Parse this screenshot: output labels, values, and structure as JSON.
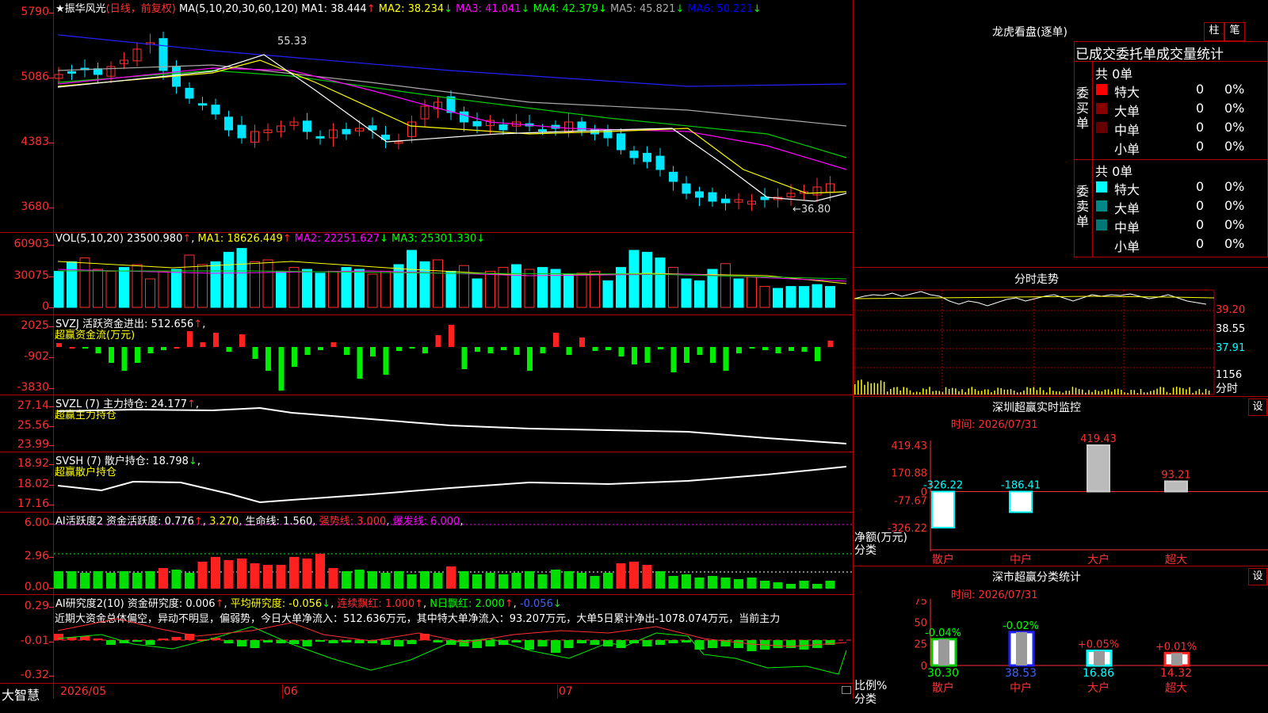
{
  "app": {
    "brand": "大智慧"
  },
  "kline": {
    "star": "★",
    "stock_name": "振华风光",
    "period": "(日线，前复权)",
    "ma_params": "MA(5,10,20,30,60,120)",
    "ma": [
      {
        "label": "MA1:",
        "value": "38.444",
        "arrow": "↑",
        "color": "#ffffff"
      },
      {
        "label": "MA2:",
        "value": "38.234",
        "arrow": "↓",
        "color": "#ffff00"
      },
      {
        "label": "MA3:",
        "value": "41.041",
        "arrow": "↓",
        "color": "#ff00ff"
      },
      {
        "label": "MA4:",
        "value": "42.379",
        "arrow": "↓",
        "color": "#00ff00"
      },
      {
        "label": "MA5:",
        "value": "45.821",
        "arrow": "↓",
        "color": "#aaaaaa"
      },
      {
        "label": "MA6:",
        "value": "50.221",
        "arrow": "↓",
        "color": "#0000ff"
      }
    ],
    "yticks": [
      "5790",
      "5086",
      "4383",
      "3680"
    ],
    "high_label": "55.33",
    "low_label": "←36.80"
  },
  "vol": {
    "header": "VOL(5,10,20)",
    "value": "23500.980",
    "ma": [
      {
        "label": "MA1:",
        "value": "18626.449",
        "arrow": "↑",
        "color": "#ffff00"
      },
      {
        "label": "MA2:",
        "value": "22251.627",
        "arrow": "↓",
        "color": "#ff00ff"
      },
      {
        "label": "MA3:",
        "value": "25301.330",
        "arrow": "↓",
        "color": "#00ff00"
      }
    ],
    "yticks": [
      "60903",
      "30075",
      "0"
    ]
  },
  "svzj": {
    "header": "SVZJ",
    "label": "活跃资金进出:",
    "value": "512.656",
    "arrow": "↑",
    "subtitle": "超赢资金流(万元)",
    "yticks": [
      "2025",
      "-902",
      "-3830"
    ]
  },
  "svzl": {
    "header": "SVZL (7)",
    "label": "主力持仓:",
    "value": "24.177",
    "arrow": "↑",
    "subtitle": "超赢主力持仓",
    "yticks": [
      "27.14",
      "25.56",
      "23.99"
    ]
  },
  "svsh": {
    "header": "SVSH (7)",
    "label": "散户持仓:",
    "value": "18.798",
    "arrow": "↓",
    "subtitle": "超赢散户持仓",
    "yticks": [
      "18.92",
      "18.02",
      "17.16"
    ]
  },
  "ai_active": {
    "header": "AI活跃度2",
    "label": "资金活跃度:",
    "value": "0.776",
    "arrow": "↑",
    "value2": "3.270",
    "life_label": "生命线:",
    "life_value": "1.560",
    "strong_label": "强势线:",
    "strong_value": "3.000",
    "burst_label": "爆发线:",
    "burst_value": "6.000",
    "yticks": [
      "6.00",
      "2.96",
      "0.00"
    ]
  },
  "ai_research": {
    "header": "AI研究度2(10)",
    "label": "资金研究度:",
    "value": "0.006",
    "arrow": "↑",
    "avg_label": "平均研究度:",
    "avg_value": "-0.056",
    "avg_arrow": "↓",
    "cont_label": "连续飘红:",
    "cont_value": "1.000",
    "cont_arrow": "↑",
    "nday_label": "N日飘红:",
    "nday_value": "2.000",
    "nday_arrow": "↑",
    "last_value": "-0.056",
    "last_arrow": "↓",
    "summary": "近期大资金总体偏空，异动不明显，偏弱势，今日大单净流入：512.636万元，其中特大单净流入：93.207万元，大单5日累计净出-1078.074万元，当前主力",
    "yticks": [
      "0.29",
      "-0.01",
      "-0.32"
    ]
  },
  "xaxis": {
    "labels": [
      "2026/05",
      "06",
      "07"
    ]
  },
  "right": {
    "lhb_title": "龙虎看盘(逐单)",
    "btn_bar": "柱",
    "btn_pen": "笔",
    "stats_title": "已成交委托单成交量统计",
    "buy_side": "委买单",
    "sell_side": "委卖单",
    "buy_total": "共 0单",
    "sell_total": "共 0单",
    "buy_rows": [
      {
        "name": "特大",
        "num": "0",
        "pct": "0%",
        "color": "#ff0000"
      },
      {
        "name": "大单",
        "num": "0",
        "pct": "0%",
        "color": "#880000"
      },
      {
        "name": "中单",
        "num": "0",
        "pct": "0%",
        "color": "#660000"
      },
      {
        "name": "小单",
        "num": "0",
        "pct": "0%",
        "color": ""
      }
    ],
    "sell_rows": [
      {
        "name": "特大",
        "num": "0",
        "pct": "0%",
        "color": "#00ffff"
      },
      {
        "name": "大单",
        "num": "0",
        "pct": "0%",
        "color": "#008888"
      },
      {
        "name": "中单",
        "num": "0",
        "pct": "0%",
        "color": "#007777"
      },
      {
        "name": "小单",
        "num": "0",
        "pct": "0%",
        "color": ""
      }
    ],
    "intraday_title": "分时走势",
    "intraday_yticks": [
      "39.20",
      "38.55",
      "37.91",
      "1156"
    ],
    "intraday_unit": "分时",
    "monitor_title": "深圳超赢实时监控",
    "monitor_btn": "设",
    "monitor_time_label": "时间:",
    "monitor_time": "2026/07/31",
    "monitor_yticks": [
      "419.43",
      "170.88",
      "0",
      "-77.67",
      "-326.22"
    ],
    "monitor_ylabel": "净额(万元)",
    "monitor_xlabel": "分类",
    "classify_title": "深市超赢分类统计",
    "classify_btn": "设",
    "classify_time_label": "时间:",
    "classify_time": "2026/07/31",
    "classify_yticks": [
      "75",
      "50",
      "25",
      "0"
    ],
    "classify_ylabel": "比例%",
    "classify_xlabel": "分类"
  },
  "chart_data": [
    {
      "type": "bar",
      "title": "深圳超赢实时监控",
      "categories": [
        "散户",
        "中户",
        "大户",
        "超大"
      ],
      "values": [
        -326.22,
        -186.41,
        419.43,
        93.21
      ],
      "labels": [
        "-326.22",
        "-186.41",
        "419.43",
        "93.21"
      ],
      "ylabel": "净额(万元)",
      "xlabel": "分类",
      "ylim": [
        -326.22,
        419.43
      ]
    },
    {
      "type": "bar",
      "title": "深市超赢分类统计",
      "categories": [
        "散户",
        "中户",
        "大户",
        "超大"
      ],
      "values": [
        30.3,
        38.53,
        16.86,
        14.32
      ],
      "labels": [
        "30.30",
        "38.53",
        "16.86",
        "14.32"
      ],
      "changes": [
        "-0.04%",
        "-0.02%",
        "+0.05%",
        "+0.01%"
      ],
      "ylabel": "比例%",
      "xlabel": "分类",
      "ylim": [
        0,
        75
      ]
    }
  ]
}
